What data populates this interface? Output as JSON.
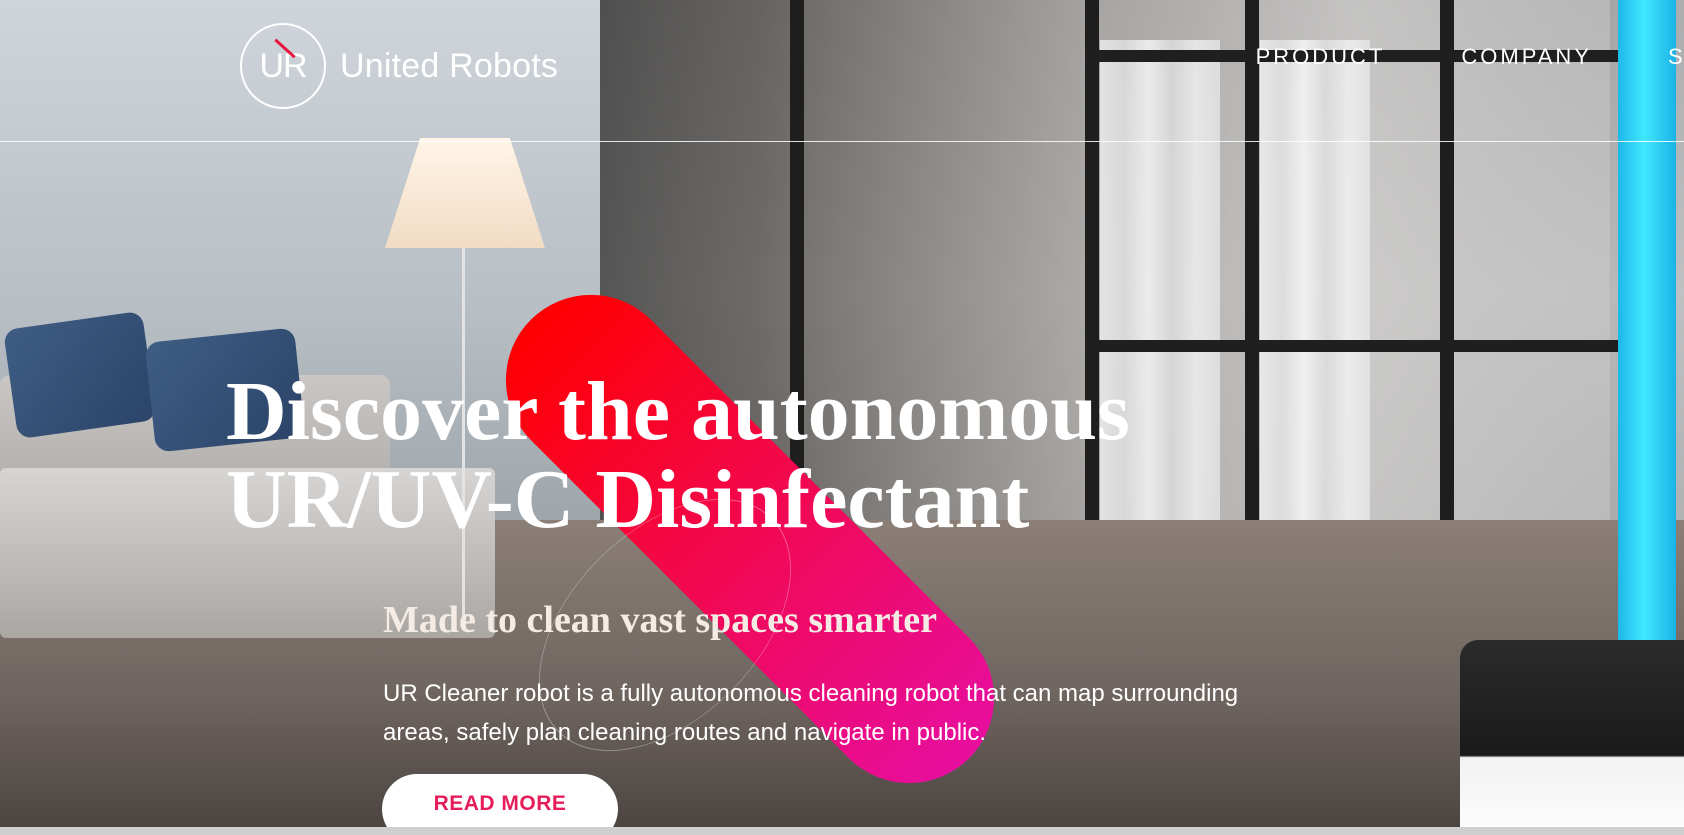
{
  "header": {
    "logo_text": "United Robots",
    "logo_monogram": "UR",
    "nav": [
      {
        "label": "PRODUCT"
      },
      {
        "label": "COMPANY"
      },
      {
        "label": "S"
      }
    ]
  },
  "hero": {
    "headline_line1": "Discover the autonomous",
    "headline_line2": "UR/UV-C Disinfectant",
    "subheadline": "Made to clean vast spaces smarter",
    "description": "UR Cleaner robot is a fully autonomous cleaning robot that can map surrounding areas, safely plan cleaning routes and navigate in public.",
    "cta_label": "READ MORE"
  },
  "colors": {
    "accent": "#e51e59",
    "pill_start": "#ff0000",
    "pill_end": "#e70e9e",
    "uv_light": "#40e8ff"
  }
}
